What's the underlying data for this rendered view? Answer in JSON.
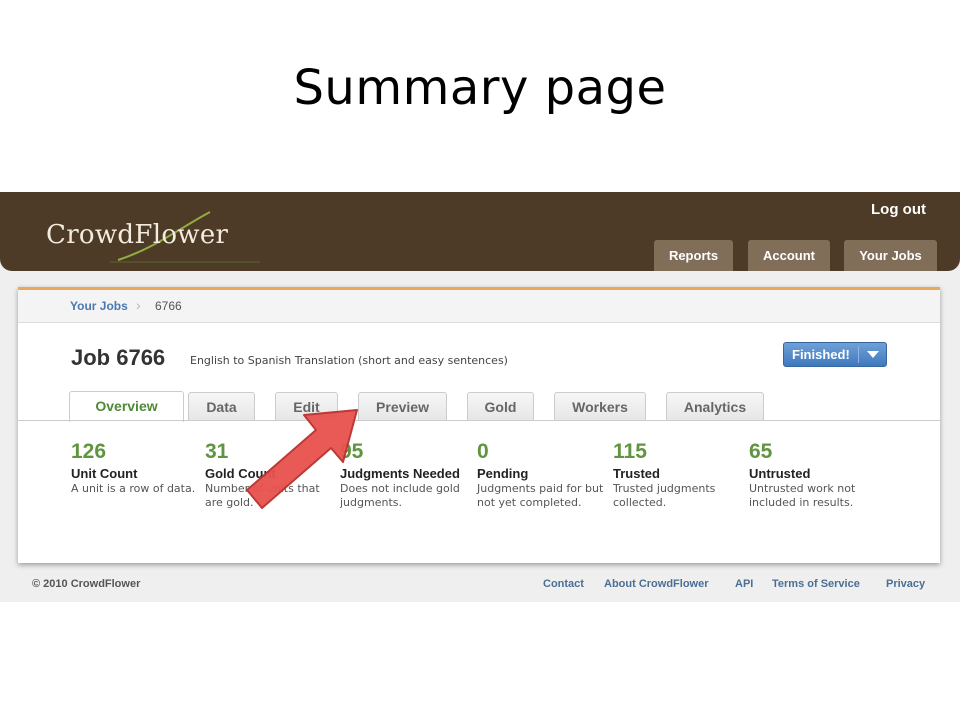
{
  "slide": {
    "title": "Summary page"
  },
  "header": {
    "logo_text": "CrowdFlower",
    "logout_label": "Log out",
    "nav": [
      "Reports",
      "Account",
      "Your Jobs"
    ]
  },
  "breadcrumb": {
    "root": "Your Jobs",
    "current": "6766"
  },
  "job": {
    "title": "Job 6766",
    "subtitle": "English to Spanish Translation (short and easy sentences)",
    "status": "Finished!"
  },
  "tabs": [
    "Overview",
    "Data",
    "Edit",
    "Preview",
    "Gold",
    "Workers",
    "Analytics"
  ],
  "active_tab": "Overview",
  "stats": [
    {
      "value": "126",
      "label": "Unit Count",
      "desc": [
        "A unit is a row of data."
      ]
    },
    {
      "value": "31",
      "label": "Gold Count",
      "desc": [
        "Number of units that",
        "are gold."
      ]
    },
    {
      "value": "95",
      "label": "Judgments Needed",
      "desc": [
        "Does not include gold",
        "judgments."
      ]
    },
    {
      "value": "0",
      "label": "Pending",
      "desc": [
        "Judgments paid for but",
        "not yet completed."
      ]
    },
    {
      "value": "115",
      "label": "Trusted",
      "desc": [
        "Trusted judgments",
        "collected."
      ]
    },
    {
      "value": "65",
      "label": "Untrusted",
      "desc": [
        "Untrusted work not",
        "included in results."
      ]
    }
  ],
  "footer": {
    "copyright": "© 2010 CrowdFlower",
    "links": [
      "Contact",
      "About CrowdFlower",
      "API",
      "Terms of Service",
      "Privacy"
    ]
  },
  "colors": {
    "header_brown": "#4d3b27",
    "accent_orange": "#e9a95a",
    "stat_green": "#5f9440",
    "status_blue": "#3f78bd",
    "arrow_red": "#e8524f"
  }
}
